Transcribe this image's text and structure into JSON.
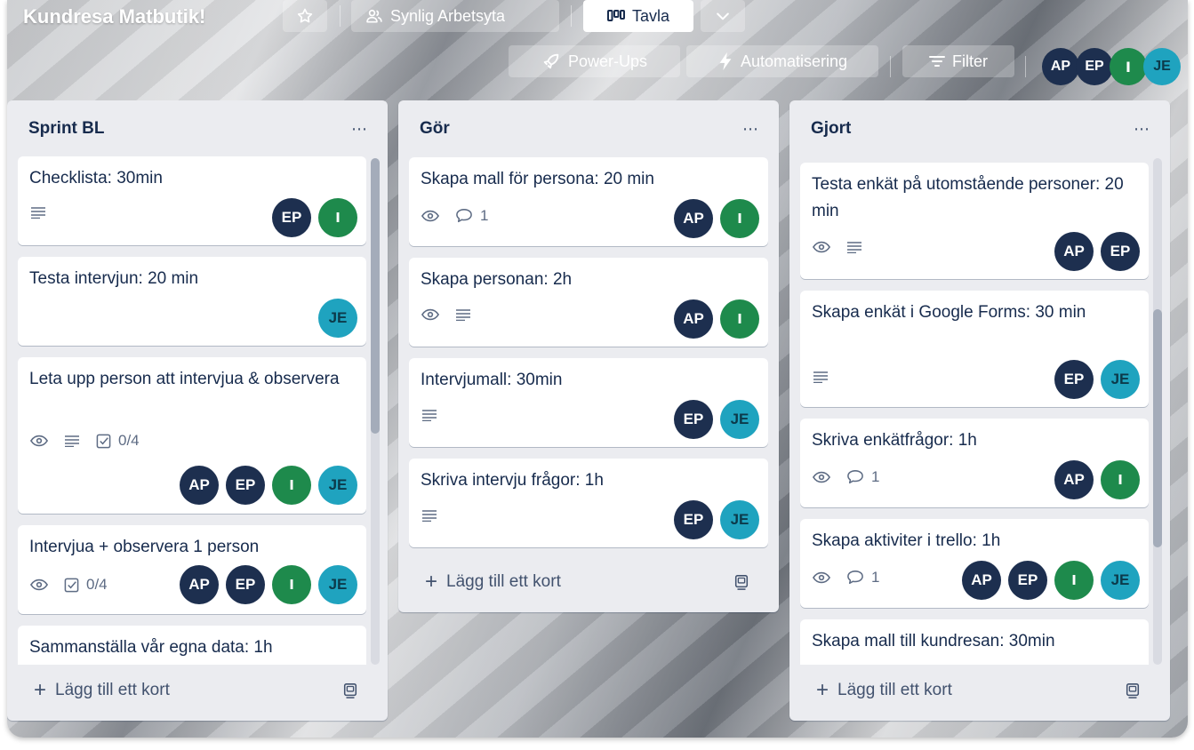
{
  "board": {
    "title": "Kundresa Matbutik!",
    "visibility_label": "Synlig Arbetsyta",
    "view_label": "Tavla",
    "powerups_label": "Power-Ups",
    "automation_label": "Automatisering",
    "filter_label": "Filter",
    "members": [
      "AP",
      "EP",
      "I",
      "JE"
    ]
  },
  "colors": {
    "member_dark": "#1d2f4f",
    "member_green": "#1e8a4c",
    "member_teal": "#1fa3bf",
    "list_bg": "#ebecf0"
  },
  "add_card_label": "Lägg till ett kort",
  "lists": [
    {
      "title": "Sprint BL",
      "cards": [
        {
          "title": "Checklista: 30min",
          "badges": [
            "description-icon"
          ],
          "members": [
            "EP",
            "I"
          ]
        },
        {
          "title": "Testa intervjun: 20 min",
          "badges": [],
          "members": [
            "JE"
          ]
        },
        {
          "title": "Leta upp person att intervjua & observera",
          "badges": [
            "watch-icon",
            "description-icon",
            "checklist-icon"
          ],
          "checklist": "0/4",
          "members": [
            "AP",
            "EP",
            "I",
            "JE"
          ]
        },
        {
          "title": "Intervjua + observera 1 person",
          "badges": [
            "watch-icon",
            "checklist-icon"
          ],
          "checklist": "0/4",
          "members": [
            "AP",
            "EP",
            "I",
            "JE"
          ]
        },
        {
          "title": "Sammanställa vår egna data: 1h",
          "badges": [],
          "members": []
        }
      ]
    },
    {
      "title": "Gör",
      "cards": [
        {
          "title": "Skapa mall för persona: 20 min",
          "badges": [
            "watch-icon",
            "comment-icon"
          ],
          "comments": "1",
          "members": [
            "AP",
            "I"
          ]
        },
        {
          "title": "Skapa personan: 2h",
          "badges": [
            "watch-icon",
            "description-icon"
          ],
          "members": [
            "AP",
            "I"
          ]
        },
        {
          "title": "Intervjumall: 30min",
          "badges": [
            "description-icon"
          ],
          "members": [
            "EP",
            "JE"
          ]
        },
        {
          "title": "Skriva intervju frågor: 1h",
          "badges": [
            "description-icon"
          ],
          "members": [
            "EP",
            "JE"
          ]
        }
      ]
    },
    {
      "title": "Gjort",
      "cards": [
        {
          "title": "Testa enkät på utomstående personer: 20 min",
          "badges": [
            "watch-icon",
            "description-icon"
          ],
          "members": [
            "AP",
            "EP"
          ]
        },
        {
          "title": "Skapa enkät i Google Forms: 30 min",
          "badges": [
            "description-icon"
          ],
          "members": [
            "EP",
            "JE"
          ]
        },
        {
          "title": "Skriva enkätfrågor: 1h",
          "badges": [
            "watch-icon",
            "comment-icon"
          ],
          "comments": "1",
          "members": [
            "AP",
            "I"
          ]
        },
        {
          "title": "Skapa aktiviter i trello: 1h",
          "badges": [
            "watch-icon",
            "comment-icon"
          ],
          "comments": "1",
          "members": [
            "AP",
            "EP",
            "I",
            "JE"
          ]
        },
        {
          "title": "Skapa mall till kundresan: 30min",
          "badges": [],
          "members": []
        }
      ]
    }
  ]
}
